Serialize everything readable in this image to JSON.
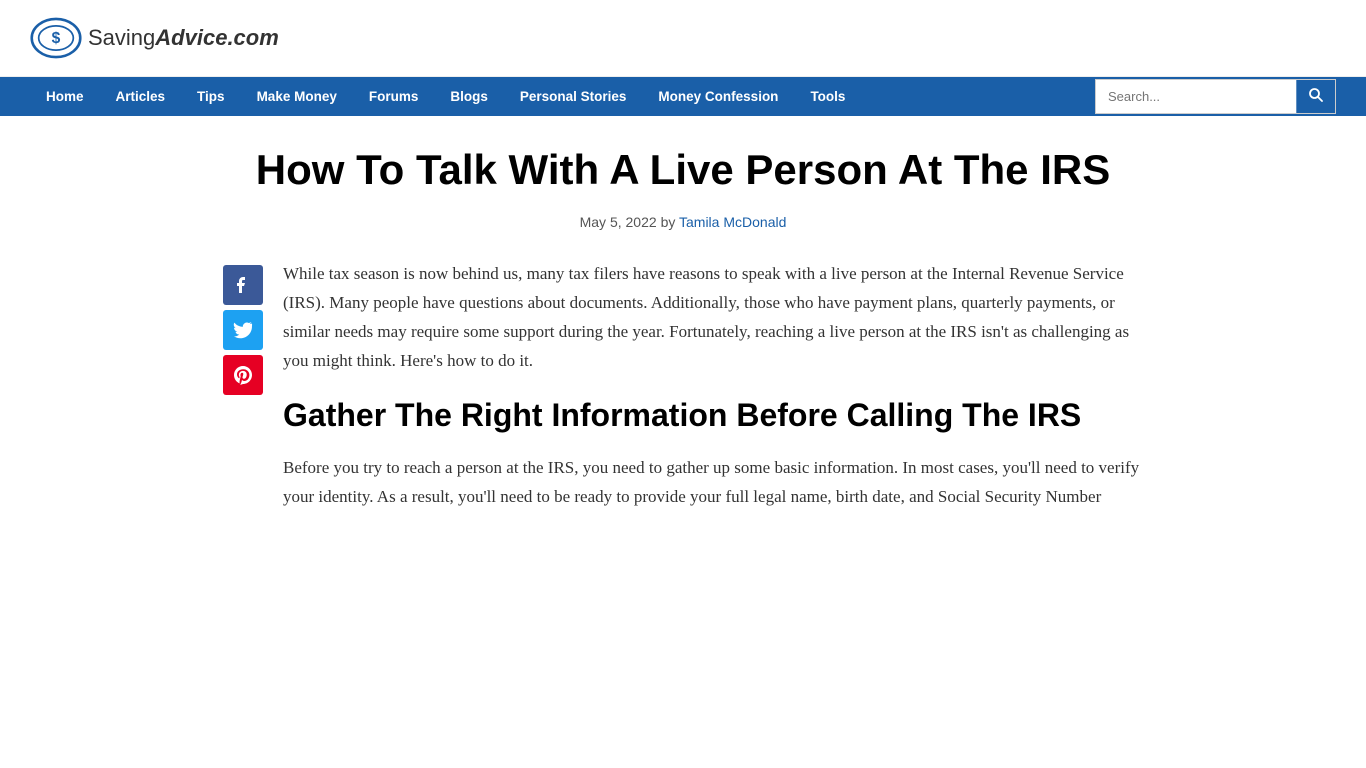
{
  "site": {
    "logo_saving": "Saving",
    "logo_advice": "Advice",
    "logo_dotcom": ".com"
  },
  "nav": {
    "items": [
      {
        "label": "Home",
        "href": "#"
      },
      {
        "label": "Articles",
        "href": "#"
      },
      {
        "label": "Tips",
        "href": "#"
      },
      {
        "label": "Make Money",
        "href": "#"
      },
      {
        "label": "Forums",
        "href": "#"
      },
      {
        "label": "Blogs",
        "href": "#"
      },
      {
        "label": "Personal Stories",
        "href": "#"
      },
      {
        "label": "Money Confession",
        "href": "#"
      },
      {
        "label": "Tools",
        "href": "#"
      }
    ],
    "search_placeholder": "Search..."
  },
  "article": {
    "title": "How To Talk With A Live Person At The IRS",
    "meta_date": "May 5, 2022",
    "meta_by": "by",
    "meta_author": "Tamila McDonald",
    "intro_paragraph": "While tax season is now behind us, many tax filers have reasons to speak with a live person at the Internal Revenue Service (IRS). Many people have questions about documents. Additionally, those who have payment plans, quarterly payments, or similar needs may require some support during the year. Fortunately, reaching a live person at the IRS isn't as challenging as you might think. Here's how to do it.",
    "section1_title": "Gather The Right Information Before Calling The IRS",
    "section1_paragraph": "Before you try to reach a person at the IRS, you need to gather up some basic information. In most cases, you'll need to verify your identity. As a result, you'll need to be ready to provide your full legal name, birth date, and Social Security Number"
  },
  "social": {
    "facebook_icon": "f",
    "twitter_icon": "t",
    "pinterest_icon": "p"
  }
}
